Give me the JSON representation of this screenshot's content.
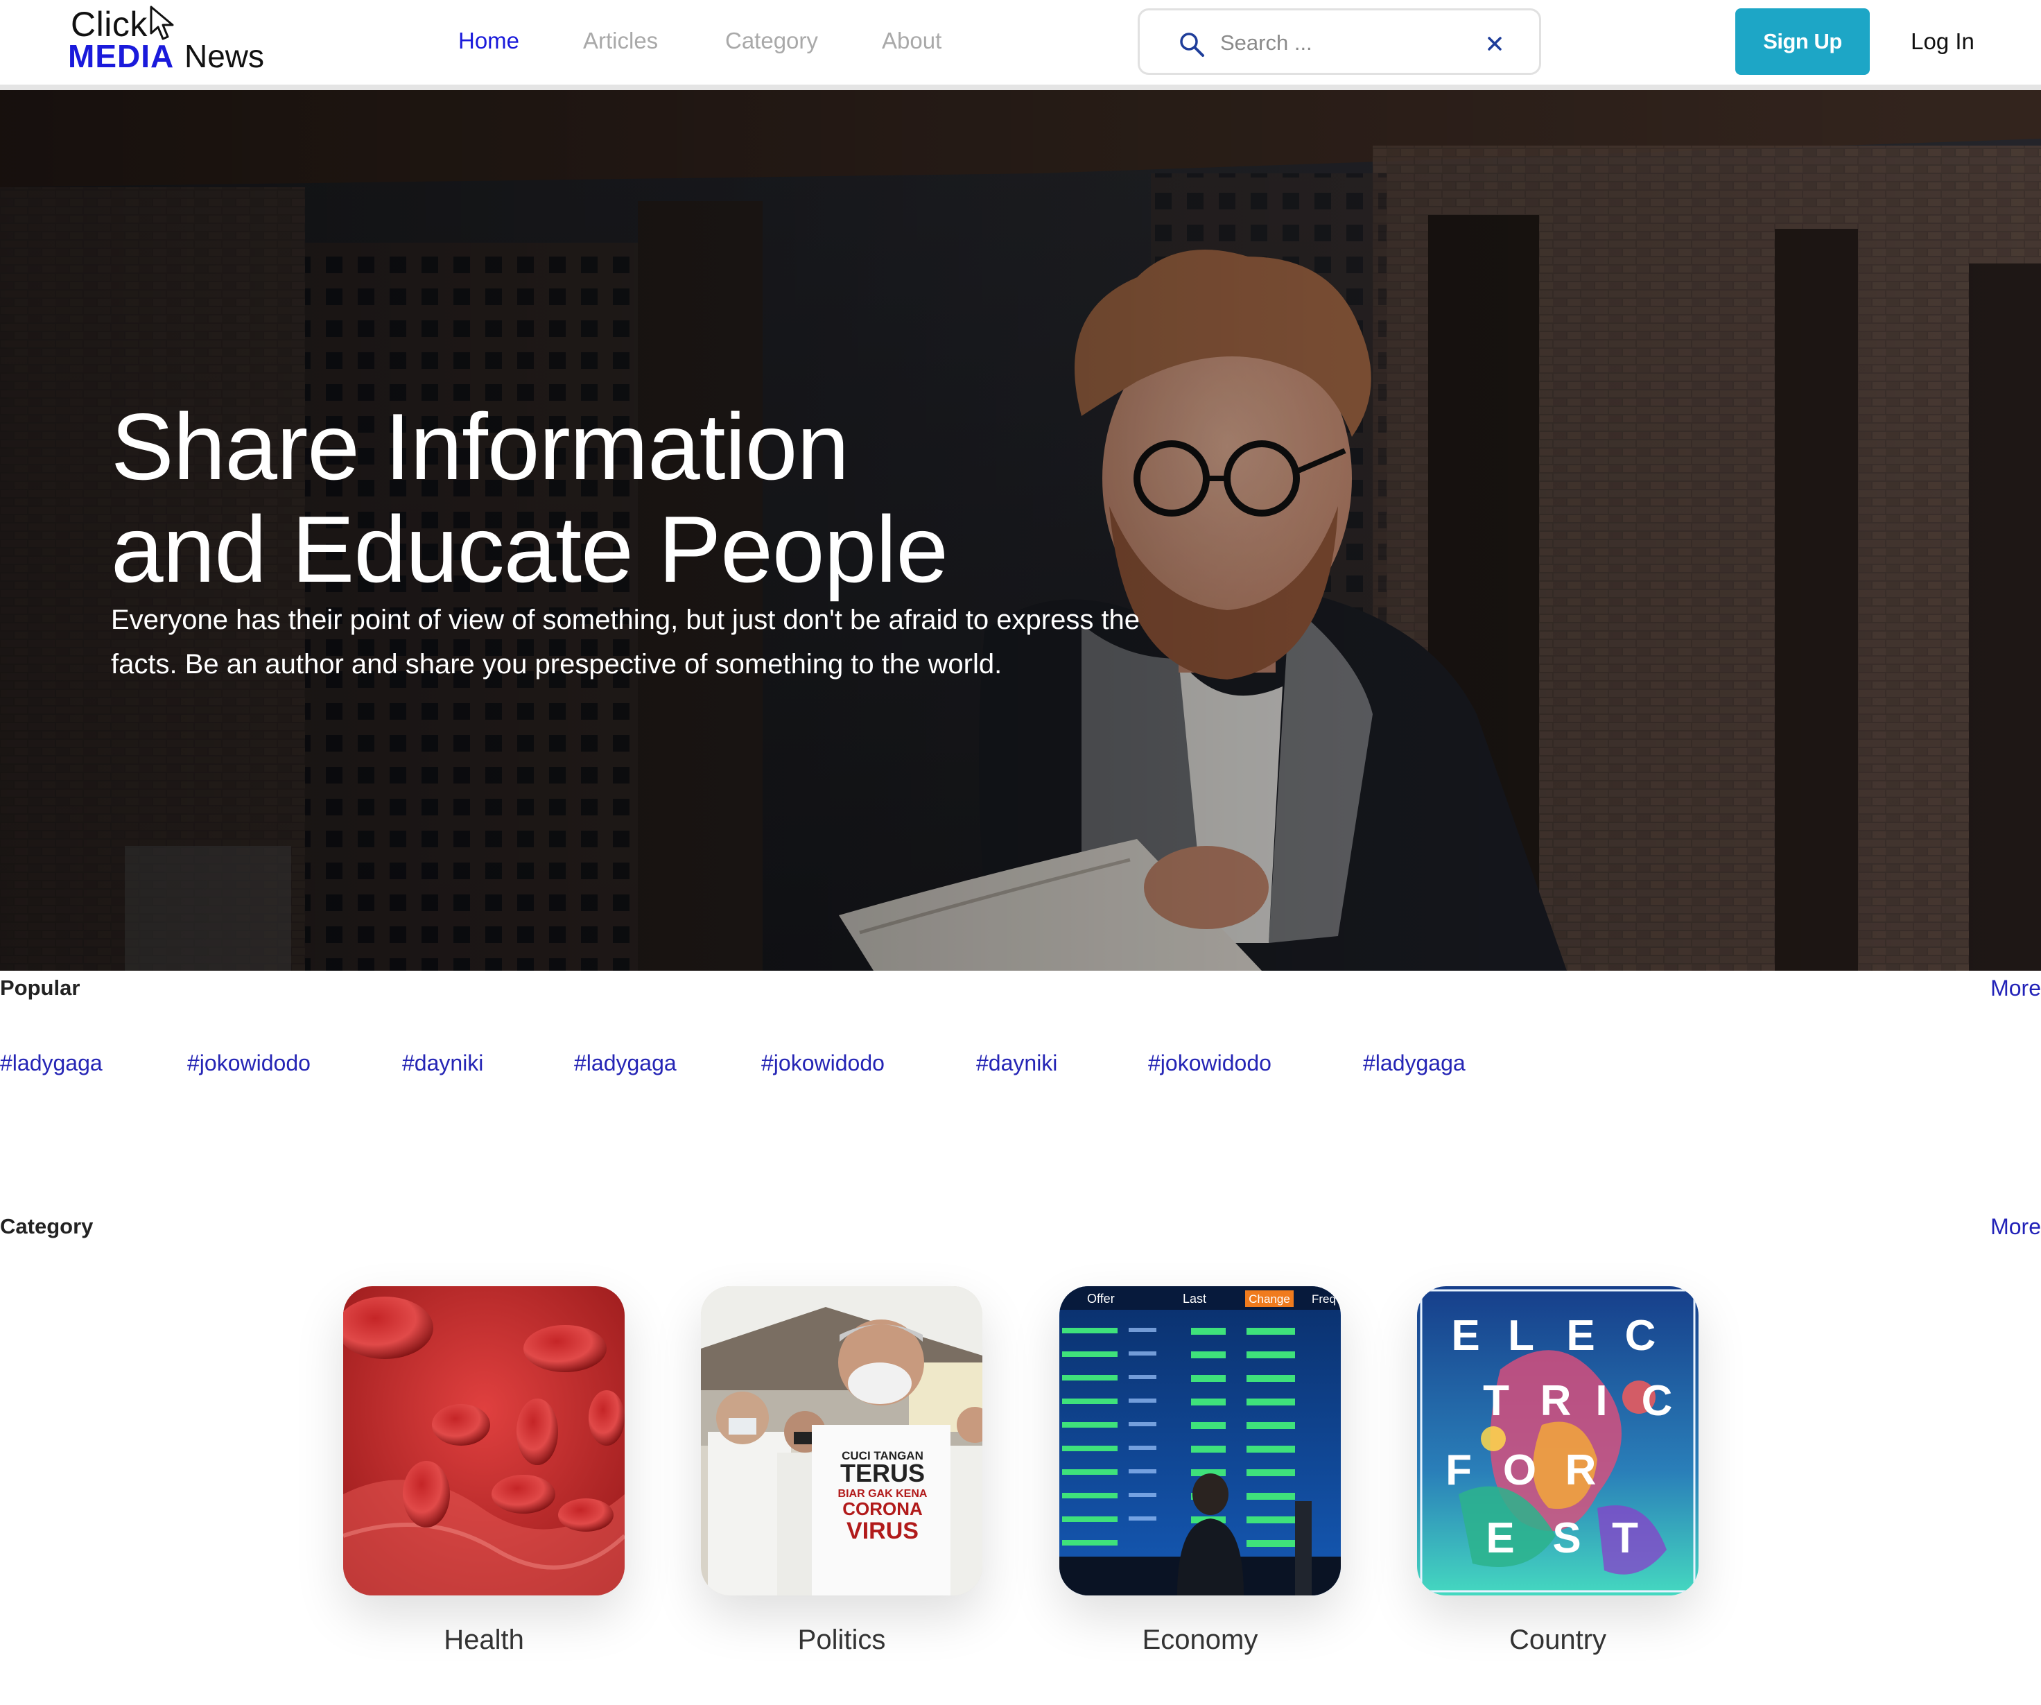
{
  "logo": {
    "line1": "Click",
    "brand_bold": "MEDIA",
    "brand_rest": "News"
  },
  "nav": {
    "items": [
      {
        "label": "Home",
        "active": true
      },
      {
        "label": "Articles",
        "active": false
      },
      {
        "label": "Category",
        "active": false
      },
      {
        "label": "About",
        "active": false
      }
    ]
  },
  "search": {
    "placeholder": "Search ...",
    "value": "",
    "icon": "search-icon",
    "clear_icon": "close-icon"
  },
  "auth": {
    "signup_label": "Sign Up",
    "login_label": "Log In"
  },
  "colors": {
    "accent": "#1da6c6",
    "brand": "#1a1adb",
    "link": "#2525b5",
    "nav_inactive": "#a9a9a9"
  },
  "hero": {
    "title_line1": "Share Information",
    "title_line2": "and Educate People",
    "text": "Everyone has their point of view of something, but just don't be afraid to express the facts. Be an author and share you prespective of something to the world."
  },
  "popular": {
    "title": "Popular",
    "more_label": "More",
    "tags": [
      "#ladygaga",
      "#jokowidodo",
      "#dayniki",
      "#ladygaga",
      "#jokowidodo",
      "#dayniki",
      "#jokowidodo",
      "#ladygaga"
    ]
  },
  "category": {
    "title": "Category",
    "more_label": "More",
    "items": [
      {
        "label": "Health"
      },
      {
        "label": "Politics"
      },
      {
        "label": "Economy"
      },
      {
        "label": "Country"
      }
    ]
  },
  "images": {
    "politics_shirt": [
      "CUCI TANGAN",
      "TERUS",
      "BIAR GAK KENA",
      "CORONA",
      "VIRUS"
    ],
    "economy_board_headers": [
      "Offer",
      "Last",
      "Change",
      "Freq"
    ],
    "country_poster": [
      "E",
      "L",
      "E",
      "C",
      "T",
      "R",
      "I",
      "C",
      "F",
      "O",
      "R",
      "E",
      "S",
      "T"
    ]
  }
}
